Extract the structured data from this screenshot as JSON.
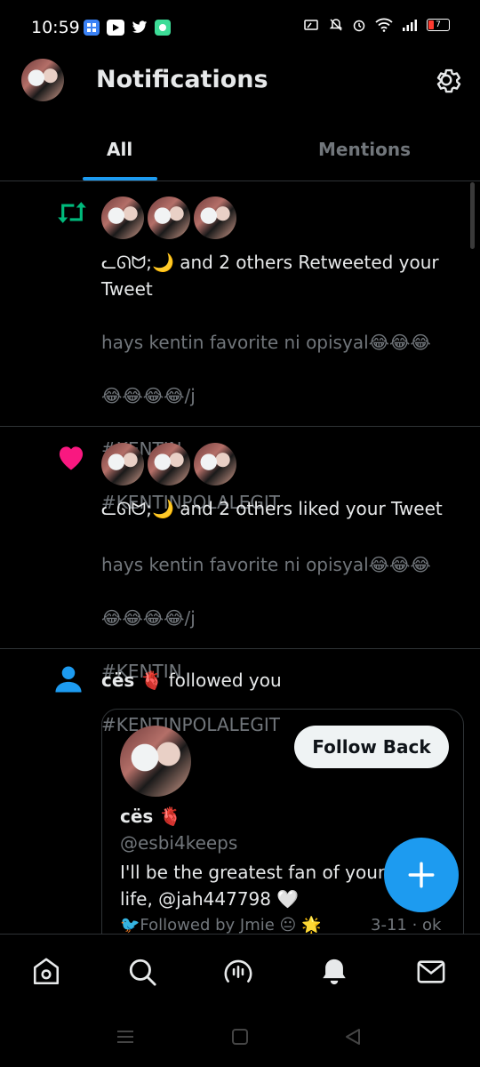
{
  "status_bar": {
    "time": "10:59",
    "battery": "7"
  },
  "header": {
    "title": "Notifications"
  },
  "tabs": [
    {
      "label": "All",
      "active": true
    },
    {
      "label": "Mentions",
      "active": false
    }
  ],
  "notifications": [
    {
      "type": "retweet",
      "icon": "retweet-icon",
      "actor": "ᓚᘏᗢ;🌙",
      "message": "and 2 others Retweeted your Tweet",
      "preview_lines": [
        "hays kentin favorite ni opisyal😂😂😂",
        "😂😂😂😂/j",
        "#KENTIN",
        "#KENTINPOLALEGIT"
      ]
    },
    {
      "type": "like",
      "icon": "heart-icon",
      "actor": "ᓚᘏᗢ;🌙",
      "message": "and 2 others liked your Tweet",
      "preview_lines": [
        "hays kentin favorite ni opisyal😂😂😂",
        "😂😂😂😂/j",
        "#KENTIN",
        "#KENTINPOLALEGIT"
      ]
    },
    {
      "type": "follow",
      "icon": "person-icon",
      "actor": "cës 🫀",
      "message": "followed you",
      "card": {
        "follow_back_label": "Follow Back",
        "name": "cës 🫀",
        "handle": "@esbi4keeps",
        "bio": "I'll be the greatest fan of your life, @jah447798 🤍",
        "followed_by": "🐦Followed by Jmie 😐 🌟",
        "date": "3-11 · ok"
      }
    }
  ],
  "colors": {
    "accent": "#1d9bf0",
    "retweet": "#00ba7c",
    "like": "#f91880",
    "muted": "#71767b"
  },
  "bottom_nav": [
    "home-icon",
    "search-icon",
    "spaces-icon",
    "bell-icon",
    "mail-icon"
  ]
}
